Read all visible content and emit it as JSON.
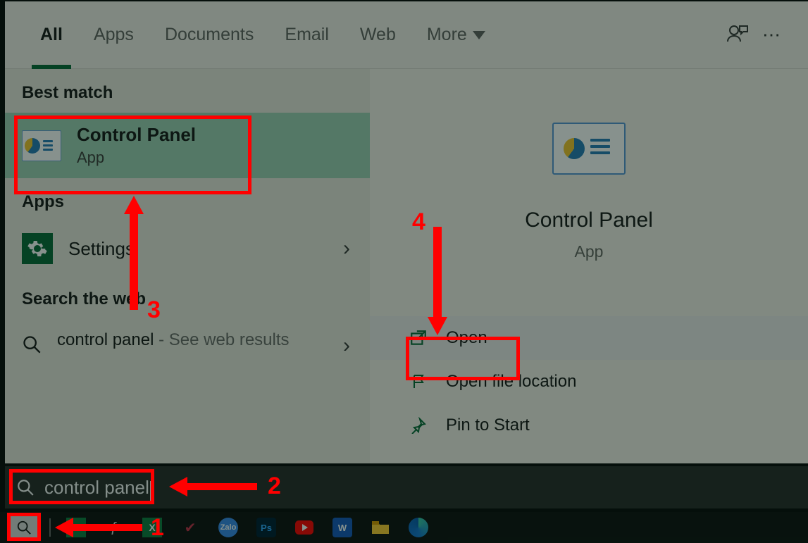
{
  "tabs": {
    "all": "All",
    "apps": "Apps",
    "documents": "Documents",
    "email": "Email",
    "web": "Web",
    "more": "More"
  },
  "left": {
    "best_match_header": "Best match",
    "best_match": {
      "title": "Control Panel",
      "sub": "App"
    },
    "apps_header": "Apps",
    "settings_label": "Settings",
    "web_header": "Search the web",
    "web_query": "control panel",
    "web_suffix": " - See web results"
  },
  "right": {
    "title": "Control Panel",
    "sub": "App",
    "actions": {
      "open": "Open",
      "open_location": "Open file location",
      "pin_start": "Pin to Start"
    }
  },
  "search_input": "control panel",
  "annotations": {
    "n1": "1",
    "n2": "2",
    "n3": "3",
    "n4": "4"
  }
}
